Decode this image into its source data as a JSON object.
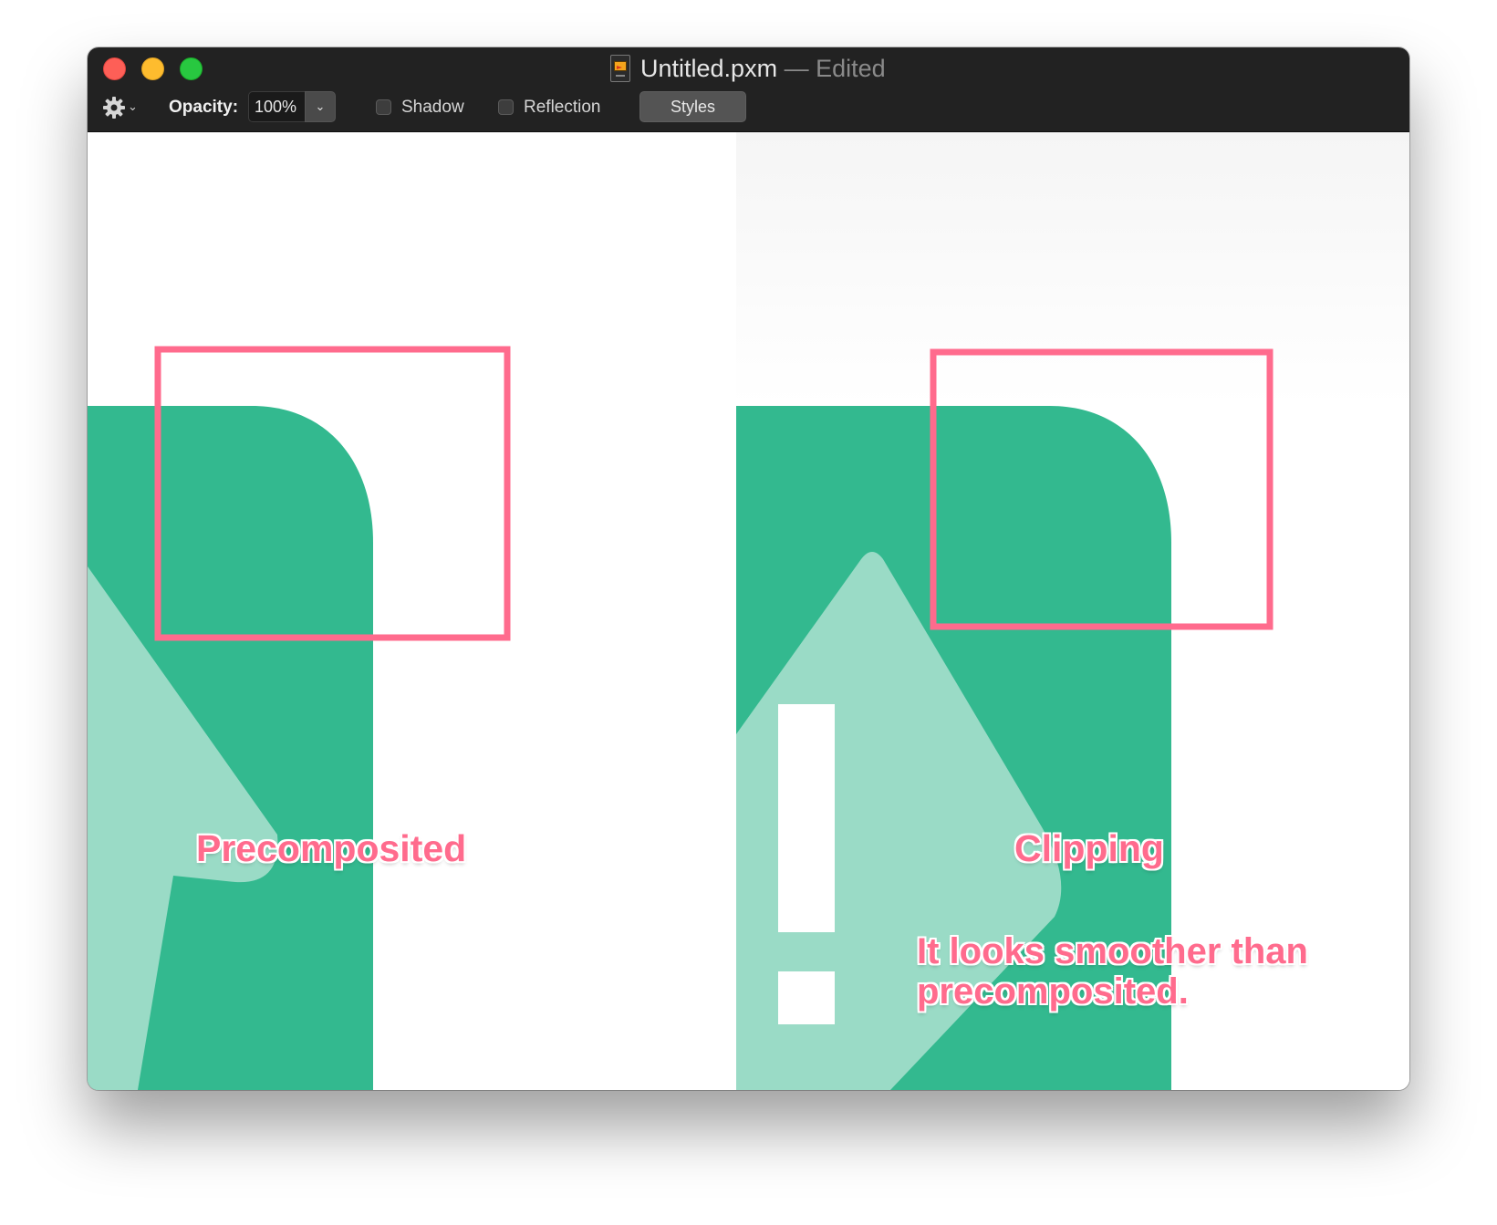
{
  "window": {
    "title": "Untitled.pxm",
    "title_separator": "—",
    "title_state": "Edited"
  },
  "toolbar": {
    "opacity_label": "Opacity:",
    "opacity_value": "100%",
    "shadow_label": "Shadow",
    "shadow_checked": false,
    "reflection_label": "Reflection",
    "reflection_checked": false,
    "styles_label": "Styles"
  },
  "canvas": {
    "left_label": "Precomposited",
    "right_label": "Clipping",
    "note_line1": "It looks smoother than",
    "note_line2": "precomposited."
  },
  "colors": {
    "titlebar": "#222222",
    "icon_green": "#33b98f",
    "icon_light_green": "#9adbc6",
    "annotation_pink": "#ff6b8d"
  },
  "icons": {
    "gear": "gear-icon",
    "chevron": "chevron-down-icon",
    "document": "pxm-document-icon"
  }
}
